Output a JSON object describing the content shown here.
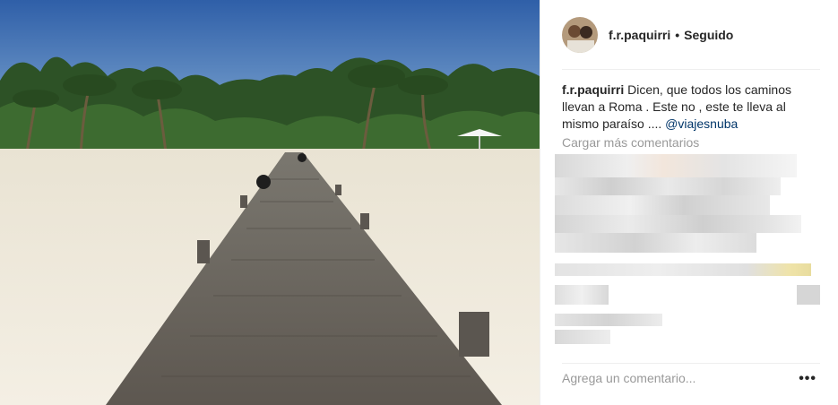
{
  "post": {
    "username": "f.r.paquirri",
    "separator": "•",
    "follow_status": "Seguido",
    "caption_text_1": "Dicen, que todos los caminos",
    "caption_text_2": "llevan a Roma . Este no , este te lleva al",
    "caption_text_3": "mismo paraíso .... ",
    "caption_mention": "@viajesnuba",
    "load_more": "Cargar más comentarios",
    "comment_placeholder": "Agrega un comentario...",
    "more_options": "•••"
  },
  "photo": {
    "subject": "wooden jetty leading to tropical beach with palm trees",
    "colors": {
      "sky": "#3f6fb5",
      "sand": "#efe9db",
      "deck": "#6e6a63",
      "palm": "#2f5a2a"
    }
  },
  "colors": {
    "text": "#262626",
    "muted": "#999999",
    "mention": "#003569",
    "divider": "#efefef"
  }
}
